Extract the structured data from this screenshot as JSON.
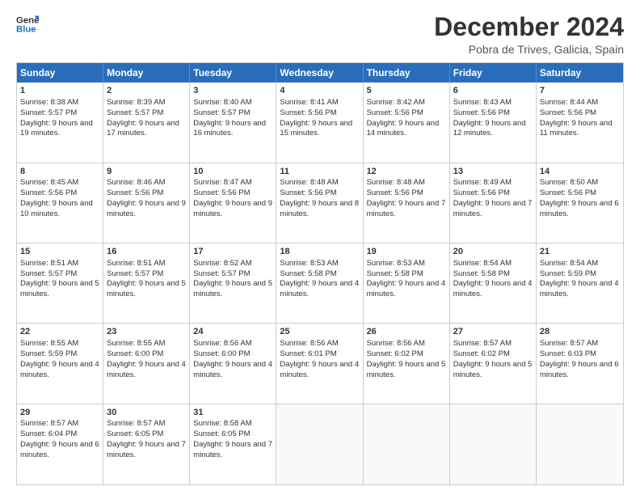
{
  "logo": {
    "line1": "General",
    "line2": "Blue"
  },
  "title": "December 2024",
  "location": "Pobra de Trives, Galicia, Spain",
  "days_of_week": [
    "Sunday",
    "Monday",
    "Tuesday",
    "Wednesday",
    "Thursday",
    "Friday",
    "Saturday"
  ],
  "weeks": [
    [
      {
        "day": "1",
        "sunrise": "Sunrise: 8:38 AM",
        "sunset": "Sunset: 5:57 PM",
        "daylight": "Daylight: 9 hours and 19 minutes."
      },
      {
        "day": "2",
        "sunrise": "Sunrise: 8:39 AM",
        "sunset": "Sunset: 5:57 PM",
        "daylight": "Daylight: 9 hours and 17 minutes."
      },
      {
        "day": "3",
        "sunrise": "Sunrise: 8:40 AM",
        "sunset": "Sunset: 5:57 PM",
        "daylight": "Daylight: 9 hours and 16 minutes."
      },
      {
        "day": "4",
        "sunrise": "Sunrise: 8:41 AM",
        "sunset": "Sunset: 5:56 PM",
        "daylight": "Daylight: 9 hours and 15 minutes."
      },
      {
        "day": "5",
        "sunrise": "Sunrise: 8:42 AM",
        "sunset": "Sunset: 5:56 PM",
        "daylight": "Daylight: 9 hours and 14 minutes."
      },
      {
        "day": "6",
        "sunrise": "Sunrise: 8:43 AM",
        "sunset": "Sunset: 5:56 PM",
        "daylight": "Daylight: 9 hours and 12 minutes."
      },
      {
        "day": "7",
        "sunrise": "Sunrise: 8:44 AM",
        "sunset": "Sunset: 5:56 PM",
        "daylight": "Daylight: 9 hours and 11 minutes."
      }
    ],
    [
      {
        "day": "8",
        "sunrise": "Sunrise: 8:45 AM",
        "sunset": "Sunset: 5:56 PM",
        "daylight": "Daylight: 9 hours and 10 minutes."
      },
      {
        "day": "9",
        "sunrise": "Sunrise: 8:46 AM",
        "sunset": "Sunset: 5:56 PM",
        "daylight": "Daylight: 9 hours and 9 minutes."
      },
      {
        "day": "10",
        "sunrise": "Sunrise: 8:47 AM",
        "sunset": "Sunset: 5:56 PM",
        "daylight": "Daylight: 9 hours and 9 minutes."
      },
      {
        "day": "11",
        "sunrise": "Sunrise: 8:48 AM",
        "sunset": "Sunset: 5:56 PM",
        "daylight": "Daylight: 9 hours and 8 minutes."
      },
      {
        "day": "12",
        "sunrise": "Sunrise: 8:48 AM",
        "sunset": "Sunset: 5:56 PM",
        "daylight": "Daylight: 9 hours and 7 minutes."
      },
      {
        "day": "13",
        "sunrise": "Sunrise: 8:49 AM",
        "sunset": "Sunset: 5:56 PM",
        "daylight": "Daylight: 9 hours and 7 minutes."
      },
      {
        "day": "14",
        "sunrise": "Sunrise: 8:50 AM",
        "sunset": "Sunset: 5:56 PM",
        "daylight": "Daylight: 9 hours and 6 minutes."
      }
    ],
    [
      {
        "day": "15",
        "sunrise": "Sunrise: 8:51 AM",
        "sunset": "Sunset: 5:57 PM",
        "daylight": "Daylight: 9 hours and 5 minutes."
      },
      {
        "day": "16",
        "sunrise": "Sunrise: 8:51 AM",
        "sunset": "Sunset: 5:57 PM",
        "daylight": "Daylight: 9 hours and 5 minutes."
      },
      {
        "day": "17",
        "sunrise": "Sunrise: 8:52 AM",
        "sunset": "Sunset: 5:57 PM",
        "daylight": "Daylight: 9 hours and 5 minutes."
      },
      {
        "day": "18",
        "sunrise": "Sunrise: 8:53 AM",
        "sunset": "Sunset: 5:58 PM",
        "daylight": "Daylight: 9 hours and 4 minutes."
      },
      {
        "day": "19",
        "sunrise": "Sunrise: 8:53 AM",
        "sunset": "Sunset: 5:58 PM",
        "daylight": "Daylight: 9 hours and 4 minutes."
      },
      {
        "day": "20",
        "sunrise": "Sunrise: 8:54 AM",
        "sunset": "Sunset: 5:58 PM",
        "daylight": "Daylight: 9 hours and 4 minutes."
      },
      {
        "day": "21",
        "sunrise": "Sunrise: 8:54 AM",
        "sunset": "Sunset: 5:59 PM",
        "daylight": "Daylight: 9 hours and 4 minutes."
      }
    ],
    [
      {
        "day": "22",
        "sunrise": "Sunrise: 8:55 AM",
        "sunset": "Sunset: 5:59 PM",
        "daylight": "Daylight: 9 hours and 4 minutes."
      },
      {
        "day": "23",
        "sunrise": "Sunrise: 8:55 AM",
        "sunset": "Sunset: 6:00 PM",
        "daylight": "Daylight: 9 hours and 4 minutes."
      },
      {
        "day": "24",
        "sunrise": "Sunrise: 8:56 AM",
        "sunset": "Sunset: 6:00 PM",
        "daylight": "Daylight: 9 hours and 4 minutes."
      },
      {
        "day": "25",
        "sunrise": "Sunrise: 8:56 AM",
        "sunset": "Sunset: 6:01 PM",
        "daylight": "Daylight: 9 hours and 4 minutes."
      },
      {
        "day": "26",
        "sunrise": "Sunrise: 8:56 AM",
        "sunset": "Sunset: 6:02 PM",
        "daylight": "Daylight: 9 hours and 5 minutes."
      },
      {
        "day": "27",
        "sunrise": "Sunrise: 8:57 AM",
        "sunset": "Sunset: 6:02 PM",
        "daylight": "Daylight: 9 hours and 5 minutes."
      },
      {
        "day": "28",
        "sunrise": "Sunrise: 8:57 AM",
        "sunset": "Sunset: 6:03 PM",
        "daylight": "Daylight: 9 hours and 6 minutes."
      }
    ],
    [
      {
        "day": "29",
        "sunrise": "Sunrise: 8:57 AM",
        "sunset": "Sunset: 6:04 PM",
        "daylight": "Daylight: 9 hours and 6 minutes."
      },
      {
        "day": "30",
        "sunrise": "Sunrise: 8:57 AM",
        "sunset": "Sunset: 6:05 PM",
        "daylight": "Daylight: 9 hours and 7 minutes."
      },
      {
        "day": "31",
        "sunrise": "Sunrise: 8:58 AM",
        "sunset": "Sunset: 6:05 PM",
        "daylight": "Daylight: 9 hours and 7 minutes."
      },
      {
        "day": "",
        "sunrise": "",
        "sunset": "",
        "daylight": ""
      },
      {
        "day": "",
        "sunrise": "",
        "sunset": "",
        "daylight": ""
      },
      {
        "day": "",
        "sunrise": "",
        "sunset": "",
        "daylight": ""
      },
      {
        "day": "",
        "sunrise": "",
        "sunset": "",
        "daylight": ""
      }
    ]
  ]
}
